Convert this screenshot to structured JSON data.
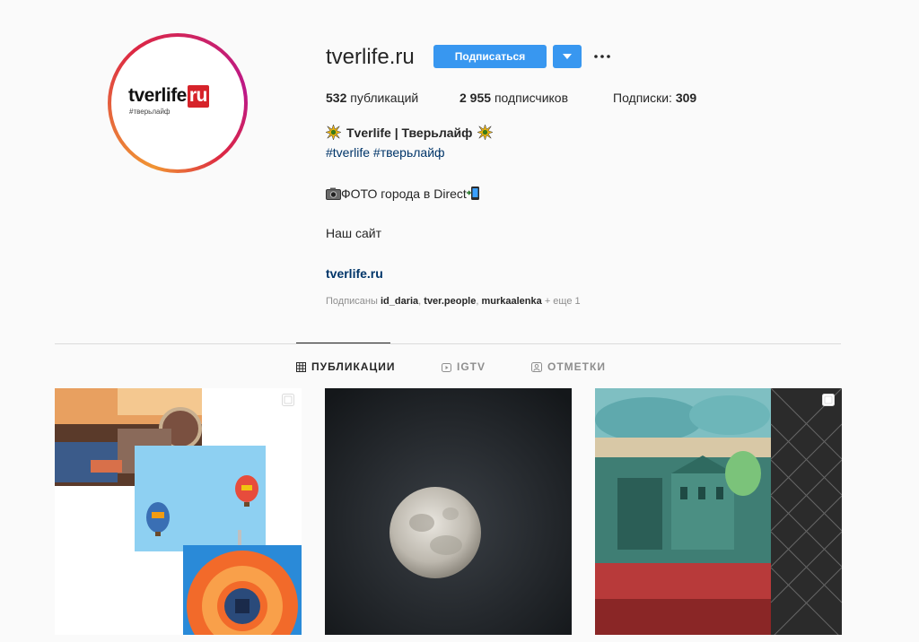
{
  "profile": {
    "username": "tverlife.ru",
    "avatar_logo_main": "tverlife",
    "avatar_logo_ru": "ru",
    "avatar_logo_sub": "#тверьлайф"
  },
  "actions": {
    "follow_label": "Подписаться"
  },
  "stats": {
    "posts_count": "532",
    "posts_label": "публикаций",
    "followers_count": "2 955",
    "followers_label": "подписчиков",
    "following_label": "Подписки:",
    "following_count": "309"
  },
  "bio": {
    "name": "Tverlife | Тверьлайф",
    "hashtag_1": "#tverlife",
    "hashtag_2": "#тверьлайф",
    "line_photo": "ФОТО города в Direct",
    "line_site": "Наш сайт",
    "link": "tverlife.ru"
  },
  "followed_by": {
    "prefix": "Подписаны",
    "user_1": "id_daria",
    "user_2": "tver.people",
    "user_3": "murkaalenka",
    "more": "+ еще 1"
  },
  "tabs": [
    {
      "label": "ПУБЛИКАЦИИ",
      "icon": "grid-icon"
    },
    {
      "label": "IGTV",
      "icon": "igtv-icon"
    },
    {
      "label": "ОТМЕТКИ",
      "icon": "tagged-icon"
    }
  ],
  "posts": [
    {
      "description_icon": "carousel-icon"
    },
    {
      "description_icon": "none"
    },
    {
      "description_icon": "carousel-icon"
    }
  ],
  "colors": {
    "accent": "#3897f0",
    "link": "#003569",
    "muted": "#8e8e8e"
  }
}
